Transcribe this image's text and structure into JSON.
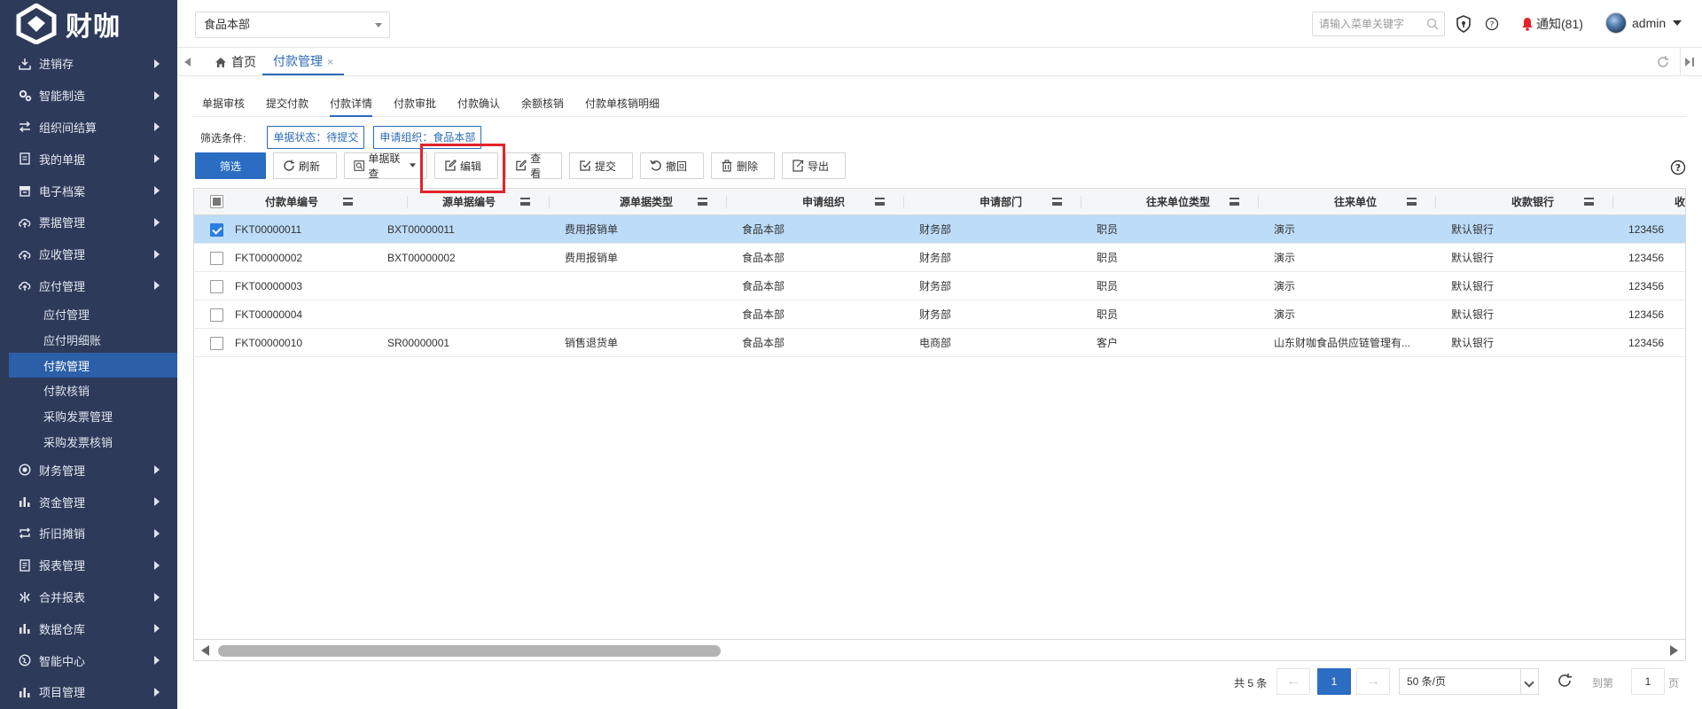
{
  "app": {
    "logo_text": "财咖"
  },
  "sidebar": {
    "items": [
      {
        "label": "进销存",
        "icon": "download-box-icon"
      },
      {
        "label": "智能制造",
        "icon": "gears-icon"
      },
      {
        "label": "组织间结算",
        "icon": "swap-arrows-icon"
      },
      {
        "label": "我的单据",
        "icon": "document-icon"
      },
      {
        "label": "电子档案",
        "icon": "archive-icon"
      },
      {
        "label": "票据管理",
        "icon": "cloud-upload-icon"
      },
      {
        "label": "应收管理",
        "icon": "cloud-upload-icon"
      },
      {
        "label": "应付管理",
        "icon": "cloud-upload-icon"
      }
    ],
    "sub_items": [
      {
        "label": "应付管理",
        "active": false
      },
      {
        "label": "应付明细账",
        "active": false
      },
      {
        "label": "付款管理",
        "active": true
      },
      {
        "label": "付款核销",
        "active": false
      },
      {
        "label": "采购发票管理",
        "active": false
      },
      {
        "label": "采购发票核销",
        "active": false
      }
    ],
    "items_after": [
      {
        "label": "财务管理",
        "icon": "target-icon"
      },
      {
        "label": "资金管理",
        "icon": "bar-chart-icon"
      },
      {
        "label": "折旧摊销",
        "icon": "repeat-icon"
      },
      {
        "label": "报表管理",
        "icon": "report-icon"
      },
      {
        "label": "合并报表",
        "icon": "merge-icon"
      },
      {
        "label": "数据仓库",
        "icon": "bar-chart-icon"
      },
      {
        "label": "智能中心",
        "icon": "globe-icon"
      },
      {
        "label": "项目管理",
        "icon": "bar-chart-icon"
      }
    ]
  },
  "topbar": {
    "org_selected": "食品本部",
    "search_placeholder": "请输入菜单关键字",
    "notice_label": "通知(81)",
    "user_name": "admin"
  },
  "tabs": {
    "home": "首页",
    "current": "付款管理",
    "close": "×"
  },
  "subtabs": [
    "单据审核",
    "提交付款",
    "付款详情",
    "付款审批",
    "付款确认",
    "余额核销",
    "付款单核销明细"
  ],
  "active_subtab": "付款详情",
  "filter": {
    "label": "筛选条件:",
    "chips": [
      "单据状态：待提交",
      "申请组织：食品本部"
    ]
  },
  "toolbar": {
    "filter": "筛选",
    "refresh": "刷新",
    "linked_query": "单据联查",
    "edit": "编辑",
    "view": "查看",
    "submit": "提交",
    "revoke": "撤回",
    "delete": "删除",
    "export": "导出"
  },
  "table": {
    "columns": [
      "付款单编号",
      "源单据编号",
      "源单据类型",
      "申请组织",
      "申请部门",
      "往来单位类型",
      "往来单位",
      "收款银行",
      "收"
    ],
    "rows": [
      {
        "selected": true,
        "cells": [
          "FKT00000011",
          "BXT00000011",
          "费用报销单",
          "食品本部",
          "财务部",
          "职员",
          "演示",
          "默认银行",
          "123456"
        ]
      },
      {
        "selected": false,
        "cells": [
          "FKT00000002",
          "BXT00000002",
          "费用报销单",
          "食品本部",
          "财务部",
          "职员",
          "演示",
          "默认银行",
          "123456"
        ]
      },
      {
        "selected": false,
        "cells": [
          "FKT00000003",
          "",
          "",
          "食品本部",
          "财务部",
          "职员",
          "演示",
          "默认银行",
          "123456"
        ]
      },
      {
        "selected": false,
        "cells": [
          "FKT00000004",
          "",
          "",
          "食品本部",
          "财务部",
          "职员",
          "演示",
          "默认银行",
          "123456"
        ]
      },
      {
        "selected": false,
        "cells": [
          "FKT00000010",
          "SR00000001",
          "销售退货单",
          "食品本部",
          "电商部",
          "客户",
          "山东财咖食品供应链管理有...",
          "默认银行",
          "123456"
        ]
      }
    ]
  },
  "pager": {
    "total": "共 5 条",
    "prev": "←",
    "next": "→",
    "current": "1",
    "page_size": "50 条/页",
    "goto_label": "到第",
    "goto_value": "1",
    "page_suffix": "页"
  },
  "colors": {
    "sidebar_bg": "#2d3a5a",
    "accent": "#2b6dc2",
    "selected_row": "#bcdcf8",
    "highlight": "#e2232a"
  }
}
